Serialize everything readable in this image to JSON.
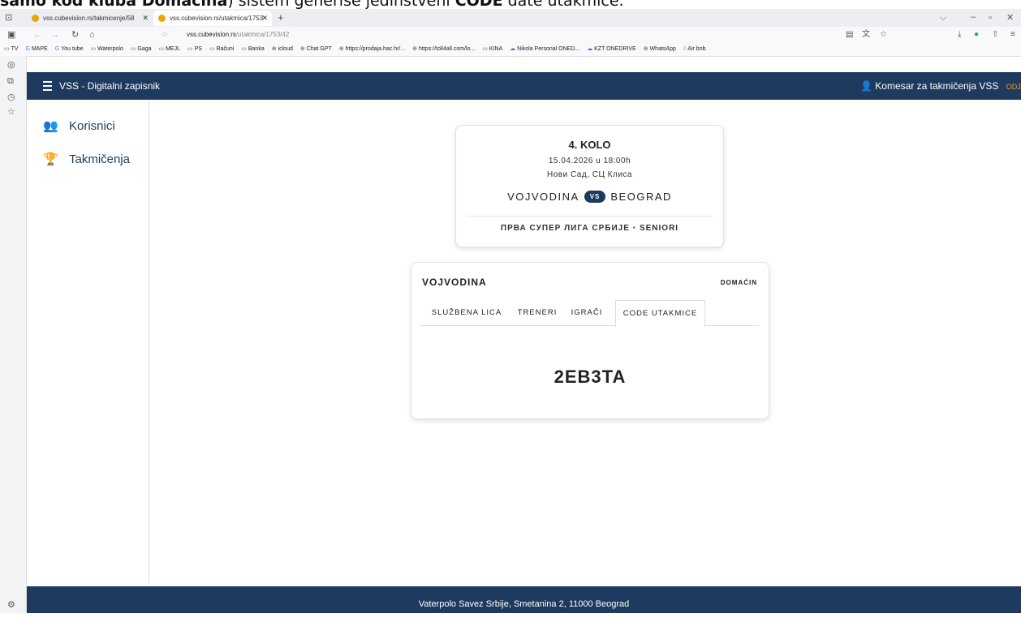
{
  "caption": {
    "part1": "samo kod kluba Domaćina",
    "part2": ") sistem generiše jedinstveni ",
    "part3": "CODE",
    "part4": " date utakmice."
  },
  "browser": {
    "tabs": [
      {
        "title": "vss.cubevision.rs/takmicenje/58",
        "active": false
      },
      {
        "title": "vss.cubevision.rs/utakmica/1753",
        "active": true
      }
    ],
    "new_tab": "+",
    "url_domain": "vss.cubevision.rs",
    "url_path": "/utakmica/1753/42",
    "bookmarks": [
      "TV",
      "MAPE",
      "You tube",
      "Waterpolo",
      "Gaga",
      "MEJL",
      "PS",
      "Računi",
      "Banka",
      "icloud",
      "Chat GPT",
      "https://prodaja.hac.hr/...",
      "https://toll4all.com/lo...",
      "KINA",
      "Nikola Personal ONED...",
      "KZT ONEDRIVE",
      "WhatsApp",
      "Air bnb"
    ]
  },
  "app": {
    "title": "VSS - Digitalni zapisnik",
    "user": "Komesar za takmičenja VSS",
    "logout": "ODJAVA",
    "nav": [
      {
        "label": "Korisnici",
        "icon": "users-icon"
      },
      {
        "label": "Takmičenja",
        "icon": "trophy-icon"
      }
    ],
    "footer": "Vaterpolo Savez Srbije, Smetanina 2, 11000 Beograd"
  },
  "match": {
    "round": "4. KOLO",
    "datetime": "15.04.2026 u 18:00h",
    "venue": "Нови Сад, СЦ Клиса",
    "home": "VOJVODINA",
    "vs": "VS",
    "away": "BEOGRAD",
    "league": "ПРВА СУПЕР ЛИГА СРБИЈЕ",
    "separator": "•",
    "category": "SENIORI"
  },
  "panel": {
    "team": "VOJVODINA",
    "role": "DOMAĆIN",
    "tabs": [
      "SLUŽBENA LICA",
      "TRENERI",
      "IGRAČI",
      "CODE UTAKMICE"
    ],
    "active_tab": "CODE UTAKMICE",
    "code": "2EB3TA"
  },
  "colors": {
    "navy": "#1e3a5f",
    "logout": "#f0a030"
  }
}
